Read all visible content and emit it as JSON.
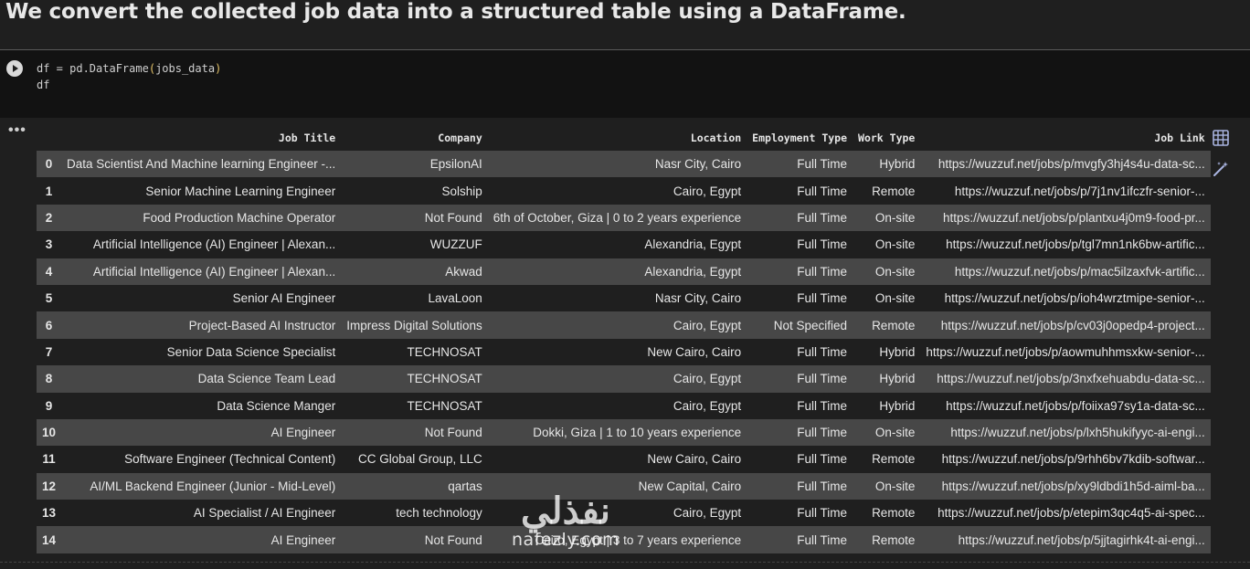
{
  "heading": "We convert the collected job data into a structured table using a DataFrame.",
  "code": {
    "line1_pre": "df = pd.DataFrame",
    "line1_open": "(",
    "line1_arg": "jobs_data",
    "line1_close": ")",
    "line2": "df"
  },
  "output_menu": "•••",
  "table": {
    "columns": [
      "",
      "Job Title",
      "Company",
      "Location",
      "Employment Type",
      "Work Type",
      "Job Link"
    ],
    "rows": [
      [
        "0",
        "Data Scientist And Machine learning Engineer -...",
        "EpsilonAI",
        "Nasr City, Cairo",
        "Full Time",
        "Hybrid",
        "https://wuzzuf.net/jobs/p/mvgfy3hj4s4u-data-sc..."
      ],
      [
        "1",
        "Senior Machine Learning Engineer",
        "Solship",
        "Cairo, Egypt",
        "Full Time",
        "Remote",
        "https://wuzzuf.net/jobs/p/7j1nv1ifczfr-senior-..."
      ],
      [
        "2",
        "Food Production Machine Operator",
        "Not Found",
        "6th of October, Giza | 0 to 2 years experience",
        "Full Time",
        "On-site",
        "https://wuzzuf.net/jobs/p/plantxu4j0m9-food-pr..."
      ],
      [
        "3",
        "Artificial Intelligence (AI) Engineer | Alexan...",
        "WUZZUF",
        "Alexandria, Egypt",
        "Full Time",
        "On-site",
        "https://wuzzuf.net/jobs/p/tgl7mn1nk6bw-artific..."
      ],
      [
        "4",
        "Artificial Intelligence (AI) Engineer | Alexan...",
        "Akwad",
        "Alexandria, Egypt",
        "Full Time",
        "On-site",
        "https://wuzzuf.net/jobs/p/mac5ilzaxfvk-artific..."
      ],
      [
        "5",
        "Senior AI Engineer",
        "LavaLoon",
        "Nasr City, Cairo",
        "Full Time",
        "On-site",
        "https://wuzzuf.net/jobs/p/ioh4wrztmipe-senior-..."
      ],
      [
        "6",
        "Project-Based AI Instructor",
        "Impress Digital Solutions",
        "Cairo, Egypt",
        "Not Specified",
        "Remote",
        "https://wuzzuf.net/jobs/p/cv03j0opedp4-project..."
      ],
      [
        "7",
        "Senior Data Science Specialist",
        "TECHNOSAT",
        "New Cairo, Cairo",
        "Full Time",
        "Hybrid",
        "https://wuzzuf.net/jobs/p/aowmuhhmsxkw-senior-..."
      ],
      [
        "8",
        "Data Science Team Lead",
        "TECHNOSAT",
        "Cairo, Egypt",
        "Full Time",
        "Hybrid",
        "https://wuzzuf.net/jobs/p/3nxfxehuabdu-data-sc..."
      ],
      [
        "9",
        "Data Science Manger",
        "TECHNOSAT",
        "Cairo, Egypt",
        "Full Time",
        "Hybrid",
        "https://wuzzuf.net/jobs/p/foiixa97sy1a-data-sc..."
      ],
      [
        "10",
        "AI Engineer",
        "Not Found",
        "Dokki, Giza | 1 to 10 years experience",
        "Full Time",
        "On-site",
        "https://wuzzuf.net/jobs/p/lxh5hukifyyc-ai-engi..."
      ],
      [
        "11",
        "Software Engineer (Technical Content)",
        "CC Global Group, LLC",
        "New Cairo, Cairo",
        "Full Time",
        "Remote",
        "https://wuzzuf.net/jobs/p/9rhh6bv7kdib-softwar..."
      ],
      [
        "12",
        "AI/ML Backend Engineer (Junior - Mid-Level)",
        "qartas",
        "New Capital, Cairo",
        "Full Time",
        "On-site",
        "https://wuzzuf.net/jobs/p/xy9ldbdi1h5d-aiml-ba..."
      ],
      [
        "13",
        "AI Specialist / AI Engineer",
        "tech technology",
        "Cairo, Egypt",
        "Full Time",
        "Remote",
        "https://wuzzuf.net/jobs/p/etepim3qc4q5-ai-spec..."
      ],
      [
        "14",
        "AI Engineer",
        "Not Found",
        "Cairo, Egypt | 3 to 7 years experience",
        "Full Time",
        "Remote",
        "https://wuzzuf.net/jobs/p/5jjtagirhk4t-ai-engi..."
      ]
    ]
  },
  "icons": {
    "table_view": "table-icon",
    "magic": "magic-wand-icon",
    "accent": "#9aa7d8"
  },
  "watermark": {
    "logo": "نفذلي",
    "url": "nafezly.com"
  }
}
